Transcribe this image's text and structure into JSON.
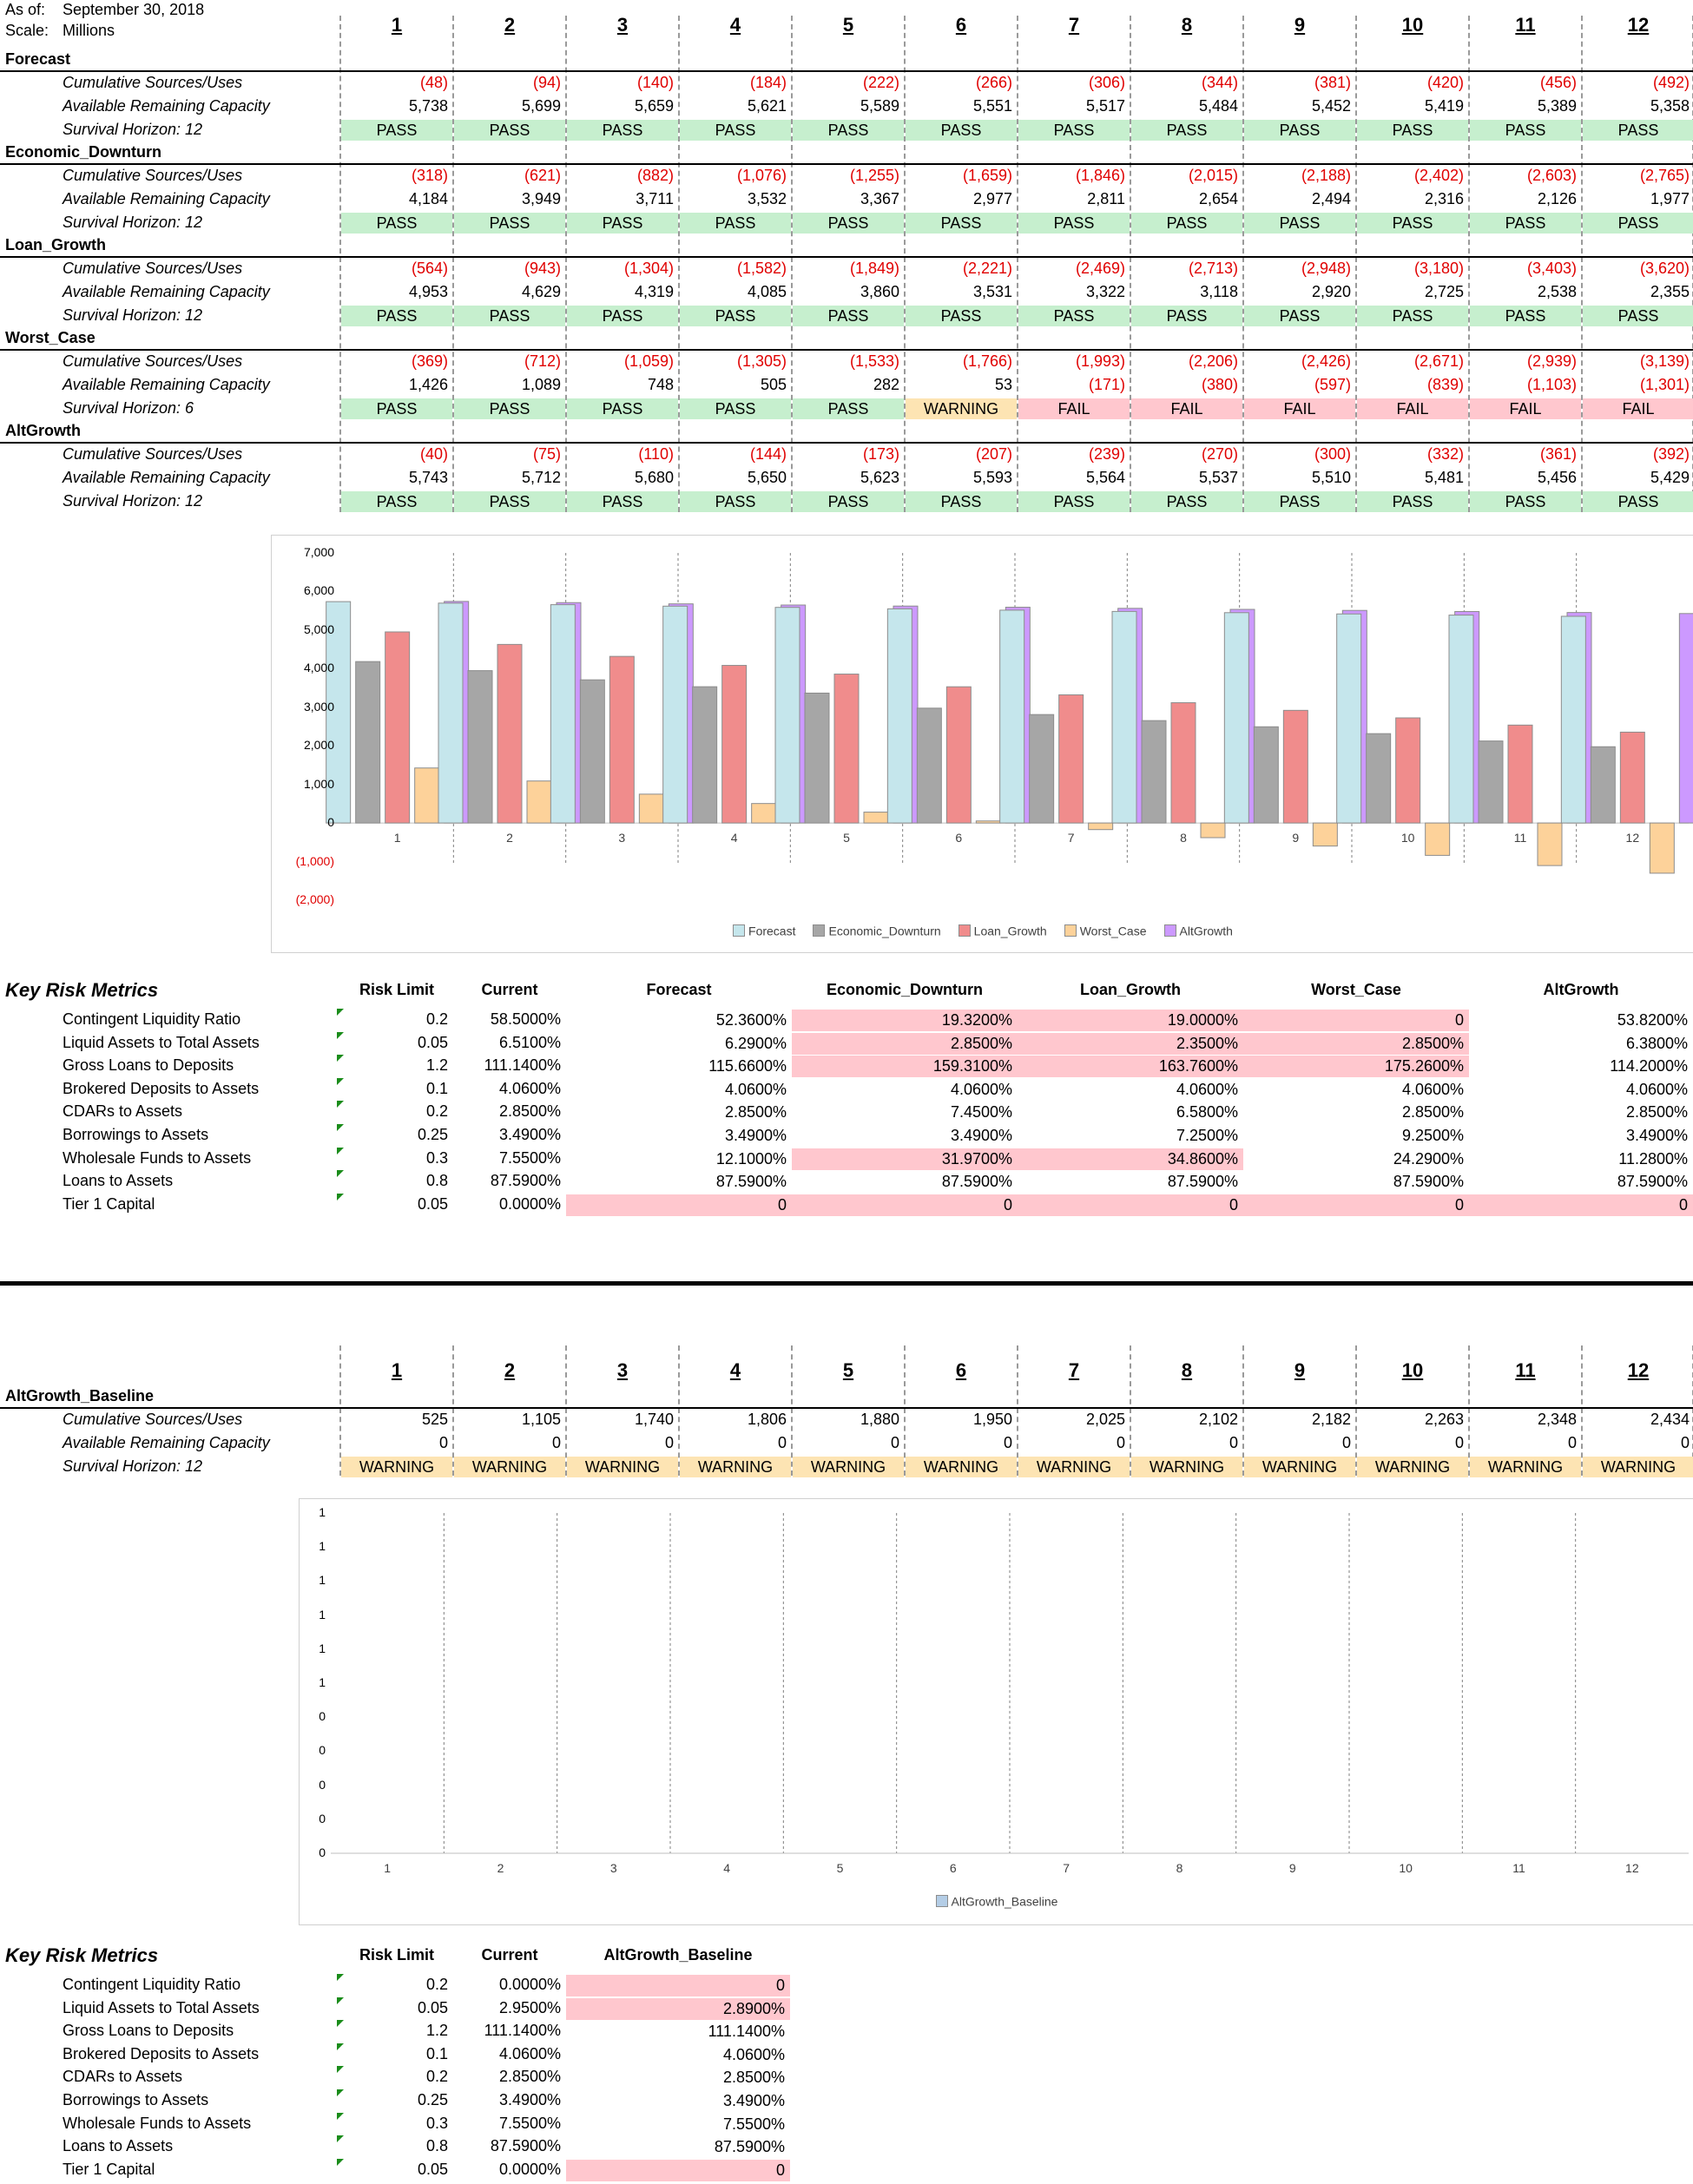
{
  "header": {
    "as_of_label": "As of:",
    "as_of_value": "September 30, 2018",
    "scale_label": "Scale:",
    "scale_value": "Millions"
  },
  "columns": [
    "1",
    "2",
    "3",
    "4",
    "5",
    "6",
    "7",
    "8",
    "9",
    "10",
    "11",
    "12"
  ],
  "row_labels": {
    "cum": "Cumulative Sources/Uses",
    "cap": "Available Remaining Capacity"
  },
  "scenarios": [
    {
      "name": "Forecast",
      "survival": "Survival Horizon: 12",
      "cum": [
        "(48)",
        "(94)",
        "(140)",
        "(184)",
        "(222)",
        "(266)",
        "(306)",
        "(344)",
        "(381)",
        "(420)",
        "(456)",
        "(492)"
      ],
      "cap": [
        "5,738",
        "5,699",
        "5,659",
        "5,621",
        "5,589",
        "5,551",
        "5,517",
        "5,484",
        "5,452",
        "5,419",
        "5,389",
        "5,358"
      ],
      "status": [
        "PASS",
        "PASS",
        "PASS",
        "PASS",
        "PASS",
        "PASS",
        "PASS",
        "PASS",
        "PASS",
        "PASS",
        "PASS",
        "PASS"
      ]
    },
    {
      "name": "Economic_Downturn",
      "survival": "Survival Horizon: 12",
      "cum": [
        "(318)",
        "(621)",
        "(882)",
        "(1,076)",
        "(1,255)",
        "(1,659)",
        "(1,846)",
        "(2,015)",
        "(2,188)",
        "(2,402)",
        "(2,603)",
        "(2,765)"
      ],
      "cap": [
        "4,184",
        "3,949",
        "3,711",
        "3,532",
        "3,367",
        "2,977",
        "2,811",
        "2,654",
        "2,494",
        "2,316",
        "2,126",
        "1,977"
      ],
      "status": [
        "PASS",
        "PASS",
        "PASS",
        "PASS",
        "PASS",
        "PASS",
        "PASS",
        "PASS",
        "PASS",
        "PASS",
        "PASS",
        "PASS"
      ]
    },
    {
      "name": "Loan_Growth",
      "survival": "Survival Horizon: 12",
      "cum": [
        "(564)",
        "(943)",
        "(1,304)",
        "(1,582)",
        "(1,849)",
        "(2,221)",
        "(2,469)",
        "(2,713)",
        "(2,948)",
        "(3,180)",
        "(3,403)",
        "(3,620)"
      ],
      "cap": [
        "4,953",
        "4,629",
        "4,319",
        "4,085",
        "3,860",
        "3,531",
        "3,322",
        "3,118",
        "2,920",
        "2,725",
        "2,538",
        "2,355"
      ],
      "status": [
        "PASS",
        "PASS",
        "PASS",
        "PASS",
        "PASS",
        "PASS",
        "PASS",
        "PASS",
        "PASS",
        "PASS",
        "PASS",
        "PASS"
      ]
    },
    {
      "name": "Worst_Case",
      "survival": "Survival Horizon: 6",
      "cum": [
        "(369)",
        "(712)",
        "(1,059)",
        "(1,305)",
        "(1,533)",
        "(1,766)",
        "(1,993)",
        "(2,206)",
        "(2,426)",
        "(2,671)",
        "(2,939)",
        "(3,139)"
      ],
      "cap": [
        "1,426",
        "1,089",
        "748",
        "505",
        "282",
        "53",
        "(171)",
        "(380)",
        "(597)",
        "(839)",
        "(1,103)",
        "(1,301)"
      ],
      "status": [
        "PASS",
        "PASS",
        "PASS",
        "PASS",
        "PASS",
        "WARNING",
        "FAIL",
        "FAIL",
        "FAIL",
        "FAIL",
        "FAIL",
        "FAIL"
      ]
    },
    {
      "name": "AltGrowth",
      "survival": "Survival Horizon: 12",
      "cum": [
        "(40)",
        "(75)",
        "(110)",
        "(144)",
        "(173)",
        "(207)",
        "(239)",
        "(270)",
        "(300)",
        "(332)",
        "(361)",
        "(392)"
      ],
      "cap": [
        "5,743",
        "5,712",
        "5,680",
        "5,650",
        "5,623",
        "5,593",
        "5,564",
        "5,537",
        "5,510",
        "5,481",
        "5,456",
        "5,429"
      ],
      "status": [
        "PASS",
        "PASS",
        "PASS",
        "PASS",
        "PASS",
        "PASS",
        "PASS",
        "PASS",
        "PASS",
        "PASS",
        "PASS",
        "PASS"
      ]
    }
  ],
  "chart_data": [
    {
      "type": "bar",
      "categories": [
        "1",
        "2",
        "3",
        "4",
        "5",
        "6",
        "7",
        "8",
        "9",
        "10",
        "11",
        "12"
      ],
      "ylim": [
        -2000,
        7000
      ],
      "yticks": [
        7000,
        6000,
        5000,
        4000,
        3000,
        2000,
        1000,
        0,
        -1000,
        -2000
      ],
      "ytick_labels": [
        "7,000",
        "6,000",
        "5,000",
        "4,000",
        "3,000",
        "2,000",
        "1,000",
        "0",
        "(1,000)",
        "(2,000)"
      ],
      "series": [
        {
          "name": "Forecast",
          "color": "#c5e6ec",
          "values": [
            5738,
            5699,
            5659,
            5621,
            5589,
            5551,
            5517,
            5484,
            5452,
            5419,
            5389,
            5358
          ]
        },
        {
          "name": "Economic_Downturn",
          "color": "#a6a6a6",
          "values": [
            4184,
            3949,
            3711,
            3532,
            3367,
            2977,
            2811,
            2654,
            2494,
            2316,
            2126,
            1977
          ]
        },
        {
          "name": "Loan_Growth",
          "color": "#f08c8c",
          "values": [
            4953,
            4629,
            4319,
            4085,
            3860,
            3531,
            3322,
            3118,
            2920,
            2725,
            2538,
            2355
          ]
        },
        {
          "name": "Worst_Case",
          "color": "#fdd29a",
          "values": [
            1426,
            1089,
            748,
            505,
            282,
            53,
            -171,
            -380,
            -597,
            -839,
            -1103,
            -1301
          ]
        },
        {
          "name": "AltGrowth",
          "color": "#cc99ff",
          "values": [
            5743,
            5712,
            5680,
            5650,
            5623,
            5593,
            5564,
            5537,
            5510,
            5481,
            5456,
            5429
          ]
        }
      ]
    },
    {
      "type": "bar",
      "categories": [
        "1",
        "2",
        "3",
        "4",
        "5",
        "6",
        "7",
        "8",
        "9",
        "10",
        "11",
        "12"
      ],
      "ytick_labels": [
        "1",
        "1",
        "1",
        "1",
        "1",
        "1",
        "0",
        "0",
        "0",
        "0",
        "0"
      ],
      "series": [
        {
          "name": "AltGrowth_Baseline",
          "color": "#b4cde6",
          "values": [
            0,
            0,
            0,
            0,
            0,
            0,
            0,
            0,
            0,
            0,
            0,
            0
          ]
        }
      ]
    }
  ],
  "krm1": {
    "title": "Key Risk Metrics",
    "headers": [
      "Risk Limit",
      "Current",
      "Forecast",
      "Economic_Downturn",
      "Loan_Growth",
      "Worst_Case",
      "AltGrowth"
    ],
    "rows": [
      {
        "label": "Contingent Liquidity Ratio",
        "limit": "0.2",
        "current": "58.5000%",
        "vals": [
          "52.3600%",
          "19.3200%",
          "19.0000%",
          "0",
          "53.8200%"
        ],
        "hl": [
          false,
          true,
          true,
          true,
          false
        ]
      },
      {
        "label": "Liquid Assets to Total Assets",
        "limit": "0.05",
        "current": "6.5100%",
        "vals": [
          "6.2900%",
          "2.8500%",
          "2.3500%",
          "2.8500%",
          "6.3800%"
        ],
        "hl": [
          false,
          true,
          true,
          true,
          false
        ]
      },
      {
        "label": "Gross Loans to Deposits",
        "limit": "1.2",
        "current": "111.1400%",
        "vals": [
          "115.6600%",
          "159.3100%",
          "163.7600%",
          "175.2600%",
          "114.2000%"
        ],
        "hl": [
          false,
          true,
          true,
          true,
          false
        ]
      },
      {
        "label": "Brokered Deposits to Assets",
        "limit": "0.1",
        "current": "4.0600%",
        "vals": [
          "4.0600%",
          "4.0600%",
          "4.0600%",
          "4.0600%",
          "4.0600%"
        ],
        "hl": [
          false,
          false,
          false,
          false,
          false
        ]
      },
      {
        "label": "CDARs to Assets",
        "limit": "0.2",
        "current": "2.8500%",
        "vals": [
          "2.8500%",
          "7.4500%",
          "6.5800%",
          "2.8500%",
          "2.8500%"
        ],
        "hl": [
          false,
          false,
          false,
          false,
          false
        ]
      },
      {
        "label": "Borrowings to Assets",
        "limit": "0.25",
        "current": "3.4900%",
        "vals": [
          "3.4900%",
          "3.4900%",
          "7.2500%",
          "9.2500%",
          "3.4900%"
        ],
        "hl": [
          false,
          false,
          false,
          false,
          false
        ]
      },
      {
        "label": "Wholesale Funds to Assets",
        "limit": "0.3",
        "current": "7.5500%",
        "vals": [
          "12.1000%",
          "31.9700%",
          "34.8600%",
          "24.2900%",
          "11.2800%"
        ],
        "hl": [
          false,
          true,
          true,
          false,
          false
        ]
      },
      {
        "label": "Loans to Assets",
        "limit": "0.8",
        "current": "87.5900%",
        "vals": [
          "87.5900%",
          "87.5900%",
          "87.5900%",
          "87.5900%",
          "87.5900%"
        ],
        "hl": [
          false,
          false,
          false,
          false,
          false
        ]
      },
      {
        "label": "Tier 1 Capital",
        "limit": "0.05",
        "current": "0.0000%",
        "vals": [
          "0",
          "0",
          "0",
          "0",
          "0"
        ],
        "hl": [
          true,
          true,
          true,
          true,
          true
        ]
      }
    ]
  },
  "baseline": {
    "name": "AltGrowth_Baseline",
    "survival": "Survival Horizon: 12",
    "cum": [
      "525",
      "1,105",
      "1,740",
      "1,806",
      "1,880",
      "1,950",
      "2,025",
      "2,102",
      "2,182",
      "2,263",
      "2,348",
      "2,434"
    ],
    "cap": [
      "0",
      "0",
      "0",
      "0",
      "0",
      "0",
      "0",
      "0",
      "0",
      "0",
      "0",
      "0"
    ],
    "status": [
      "WARNING",
      "WARNING",
      "WARNING",
      "WARNING",
      "WARNING",
      "WARNING",
      "WARNING",
      "WARNING",
      "WARNING",
      "WARNING",
      "WARNING",
      "WARNING"
    ]
  },
  "krm2": {
    "title": "Key Risk Metrics",
    "headers": [
      "Risk Limit",
      "Current",
      "AltGrowth_Baseline"
    ],
    "rows": [
      {
        "label": "Contingent Liquidity Ratio",
        "limit": "0.2",
        "current": "0.0000%",
        "vals": [
          "0"
        ],
        "hl": [
          true
        ]
      },
      {
        "label": "Liquid Assets to Total Assets",
        "limit": "0.05",
        "current": "2.9500%",
        "vals": [
          "2.8900%"
        ],
        "hl": [
          true
        ]
      },
      {
        "label": "Gross Loans to Deposits",
        "limit": "1.2",
        "current": "111.1400%",
        "vals": [
          "111.1400%"
        ],
        "hl": [
          false
        ]
      },
      {
        "label": "Brokered Deposits to Assets",
        "limit": "0.1",
        "current": "4.0600%",
        "vals": [
          "4.0600%"
        ],
        "hl": [
          false
        ]
      },
      {
        "label": "CDARs to Assets",
        "limit": "0.2",
        "current": "2.8500%",
        "vals": [
          "2.8500%"
        ],
        "hl": [
          false
        ]
      },
      {
        "label": "Borrowings to Assets",
        "limit": "0.25",
        "current": "3.4900%",
        "vals": [
          "3.4900%"
        ],
        "hl": [
          false
        ]
      },
      {
        "label": "Wholesale Funds to Assets",
        "limit": "0.3",
        "current": "7.5500%",
        "vals": [
          "7.5500%"
        ],
        "hl": [
          false
        ]
      },
      {
        "label": "Loans to Assets",
        "limit": "0.8",
        "current": "87.5900%",
        "vals": [
          "87.5900%"
        ],
        "hl": [
          false
        ]
      },
      {
        "label": "Tier 1 Capital",
        "limit": "0.05",
        "current": "0.0000%",
        "vals": [
          "0"
        ],
        "hl": [
          true
        ]
      }
    ]
  }
}
